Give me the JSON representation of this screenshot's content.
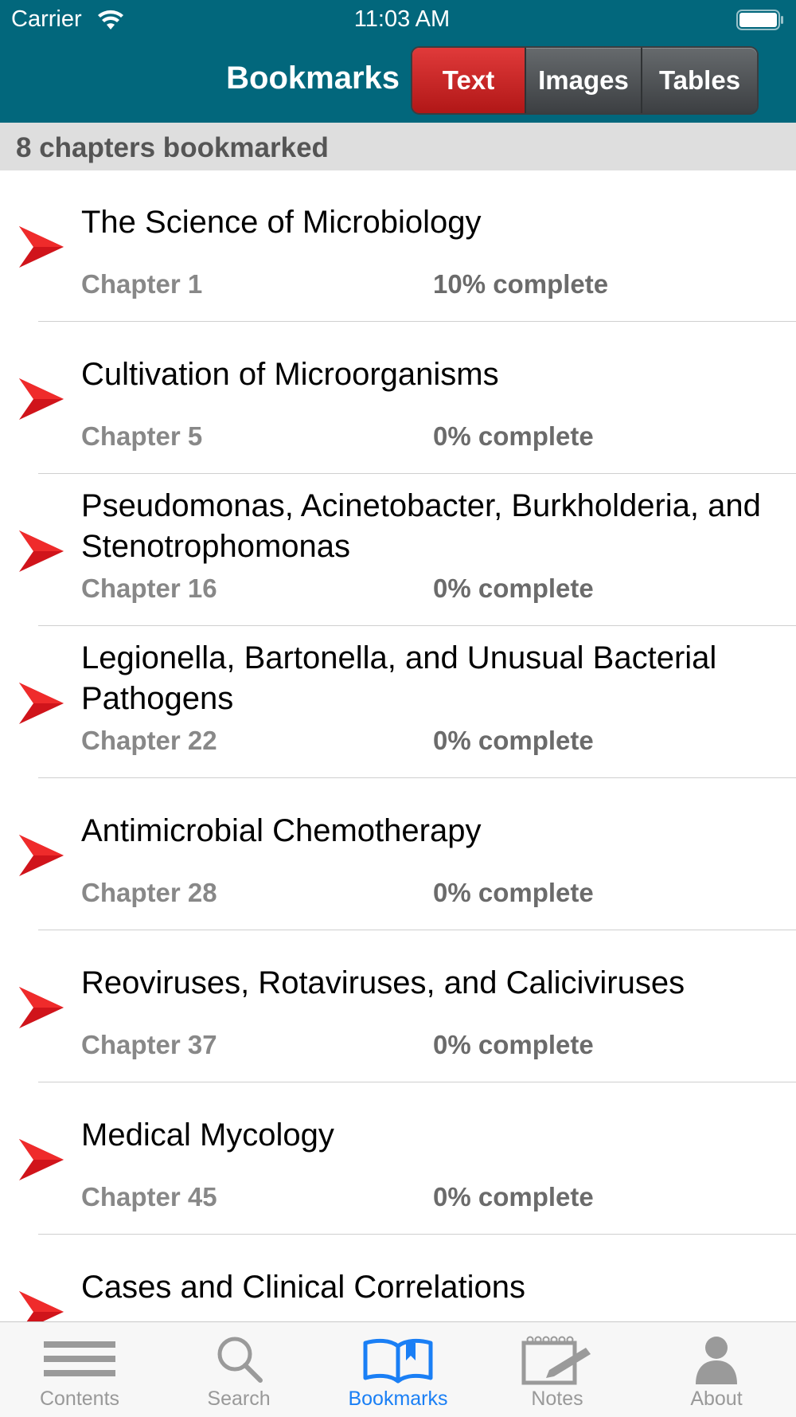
{
  "status_bar": {
    "carrier": "Carrier",
    "time": "11:03 AM",
    "wifi_icon": "wifi-icon",
    "battery_icon": "battery-icon"
  },
  "header": {
    "title": "Bookmarks",
    "segments": [
      "Text",
      "Images",
      "Tables"
    ],
    "selected_segment": "Text",
    "bg_color": "#02677c",
    "active_color": "#c62828"
  },
  "count_label": "8 chapters bookmarked",
  "bookmarks": [
    {
      "title": "The Science of Microbiology",
      "chapter": "Chapter 1",
      "progress": "10% complete"
    },
    {
      "title": "Cultivation of Microorganisms",
      "chapter": "Chapter 5",
      "progress": "0% complete"
    },
    {
      "title": "Pseudomonas, Acinetobacter, Burkholderia, and Stenotrophomonas",
      "chapter": "Chapter 16",
      "progress": "0% complete"
    },
    {
      "title": "Legionella, Bartonella, and Unusual Bacterial Pathogens",
      "chapter": "Chapter 22",
      "progress": "0% complete"
    },
    {
      "title": "Antimicrobial Chemotherapy",
      "chapter": "Chapter 28",
      "progress": "0% complete"
    },
    {
      "title": "Reoviruses, Rotaviruses, and Caliciviruses",
      "chapter": "Chapter 37",
      "progress": "0% complete"
    },
    {
      "title": "Medical Mycology",
      "chapter": "Chapter 45",
      "progress": "0% complete"
    },
    {
      "title": "Cases and Clinical Correlations",
      "chapter": "",
      "progress": ""
    }
  ],
  "tabbar": {
    "items": [
      {
        "label": "Contents",
        "icon": "list-icon"
      },
      {
        "label": "Search",
        "icon": "search-icon"
      },
      {
        "label": "Bookmarks",
        "icon": "open-book-icon"
      },
      {
        "label": "Notes",
        "icon": "notepad-icon"
      },
      {
        "label": "About",
        "icon": "person-icon"
      }
    ],
    "selected": "Bookmarks",
    "active_color": "#1a7ff5",
    "inactive_color": "#999999"
  }
}
